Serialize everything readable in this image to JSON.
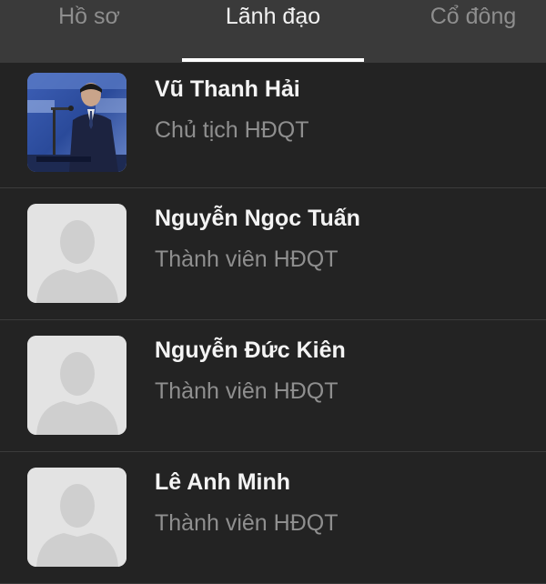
{
  "tabs": [
    {
      "label": "Hồ sơ",
      "active": false
    },
    {
      "label": "Lãnh đạo",
      "active": true
    },
    {
      "label": "Cổ đông",
      "active": false
    }
  ],
  "leaders": [
    {
      "name": "Vũ Thanh Hải",
      "role": "Chủ tịch HĐQT",
      "avatar": "photo"
    },
    {
      "name": "Nguyễn Ngọc Tuấn",
      "role": "Thành viên HĐQT",
      "avatar": "placeholder-person-icon"
    },
    {
      "name": "Nguyễn Đức Kiên",
      "role": "Thành viên HĐQT",
      "avatar": "placeholder-person-icon"
    },
    {
      "name": "Lê Anh Minh",
      "role": "Thành viên HĐQT",
      "avatar": "placeholder-person-icon"
    }
  ],
  "colors": {
    "background": "#232323",
    "tabbar": "#3a3a3a",
    "active_text": "#f2f2f2",
    "inactive_text": "#8e8e8e",
    "indicator": "#ffffff"
  }
}
